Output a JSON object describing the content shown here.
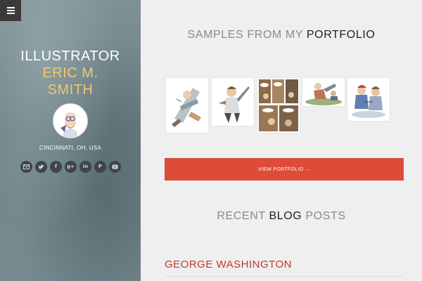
{
  "sidebar": {
    "title_line1": "ILLUSTRATOR",
    "title_line2": "ERIC M.",
    "title_line3": "SMITH",
    "location": "CINCINNATI, OH, USA",
    "social_icons": [
      "email-icon",
      "twitter-icon",
      "facebook-icon",
      "google-plus-icon",
      "linkedin-icon",
      "pinterest-icon",
      "youtube-icon"
    ]
  },
  "portfolio": {
    "title_prefix": "SAMPLES FROM MY ",
    "title_emphasis": "PORTFOLIO",
    "button_label": "VIEW PORTFOLIO →"
  },
  "blog": {
    "title_prefix": "RECENT ",
    "title_emphasis": "BLOG",
    "title_suffix": " POSTS",
    "posts": [
      {
        "title": "GEORGE WASHINGTON"
      }
    ]
  },
  "colors": {
    "accent": "#dd4b39",
    "title_highlight": "#f2c76b",
    "post_title": "#c0392b"
  }
}
